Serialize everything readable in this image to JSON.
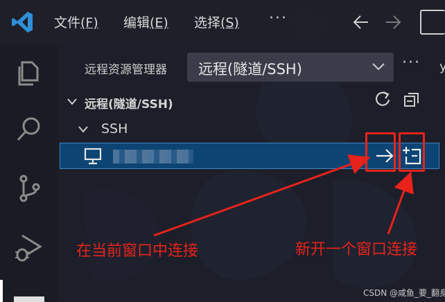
{
  "titlebar": {
    "menu": [
      {
        "label": "文件",
        "key": "(F)"
      },
      {
        "label": "编辑",
        "key": "(E)"
      },
      {
        "label": "选择",
        "key": "(S)"
      }
    ],
    "more": "···"
  },
  "sidebar": {
    "title": "远程资源管理器",
    "remote_select": "远程(隧道/SSH)",
    "more": "···",
    "clipped": "y",
    "section_title": "远程(隧道/SSH)",
    "group_label": "SSH",
    "host_name": "server-host"
  },
  "annotations": {
    "connect_here": "在当前窗口中连接",
    "connect_new": "新开一个窗口连接"
  },
  "watermark": "CSDN @咸鱼_要_翻身",
  "colors": {
    "accent": "#0c4473",
    "annotation": "#e8231b"
  },
  "icons": [
    "vscode-logo-icon",
    "explorer-icon",
    "search-icon",
    "source-control-icon",
    "run-debug-icon",
    "back-arrow-icon",
    "forward-arrow-icon",
    "refresh-icon",
    "collapse-all-icon",
    "monitor-icon",
    "connect-arrow-icon",
    "new-window-icon"
  ]
}
